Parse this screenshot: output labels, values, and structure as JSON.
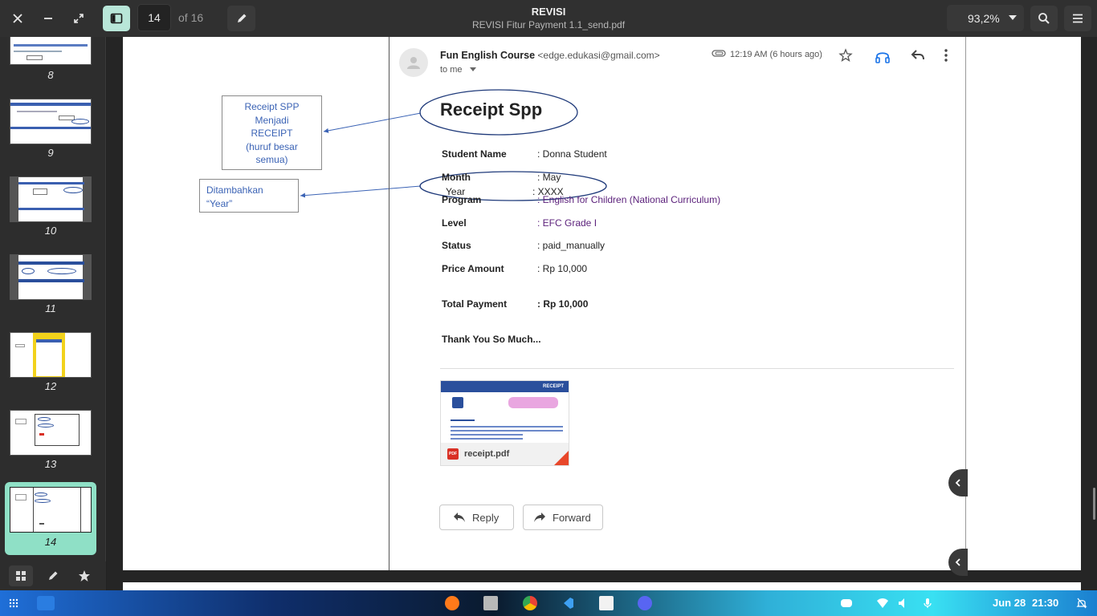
{
  "header": {
    "current_page": "14",
    "page_of": "of 16",
    "title": "REVISI",
    "subtitle": "REVISI Fitur Payment 1.1_send.pdf",
    "zoom": "93,2%"
  },
  "sidebar": {
    "thumbnails": [
      {
        "label": "8"
      },
      {
        "label": "9"
      },
      {
        "label": "10"
      },
      {
        "label": "11"
      },
      {
        "label": "12"
      },
      {
        "label": "13"
      },
      {
        "label": "14",
        "active": true
      }
    ]
  },
  "annotations": {
    "receipt_note_lines": [
      "Receipt SPP",
      "Menjadi",
      "RECEIPT",
      "(huruf besar",
      "semua)"
    ],
    "year_note_lines": [
      "Ditambahkan",
      "“Year”"
    ]
  },
  "email": {
    "sender_name": "Fun English Course",
    "sender_email": "<edge.edukasi@gmail.com>",
    "to": "to me",
    "time": "12:19 AM (6 hours ago)",
    "heading": "Receipt Spp",
    "fields": {
      "student_name_label": "Student Name",
      "student_name_value": ": Donna Student",
      "month_label": "Month",
      "month_value": ": May",
      "year_label": "Year",
      "year_value": ": XXXX",
      "program_label": "Program",
      "program_value": ": English for Children (National Curriculum)",
      "level_label": "Level",
      "level_value": ": EFC Grade I",
      "status_label": "Status",
      "status_value": ": paid_manually",
      "price_label": "Price Amount",
      "price_value": ": Rp 10,000",
      "total_label": "Total Payment",
      "total_value": ": Rp 10,000",
      "thanks": "Thank You So Much..."
    },
    "attachment": {
      "header": "RECEIPT",
      "filename": "receipt.pdf",
      "badge": "PDF"
    },
    "reply_label": "Reply",
    "forward_label": "Forward"
  },
  "taskbar": {
    "date": "Jun 28",
    "time": "21:30"
  },
  "colors": {
    "accent": "#8fe0c6",
    "annotation_blue": "#3b63b5",
    "ellipse_navy": "#1f3a7a"
  }
}
